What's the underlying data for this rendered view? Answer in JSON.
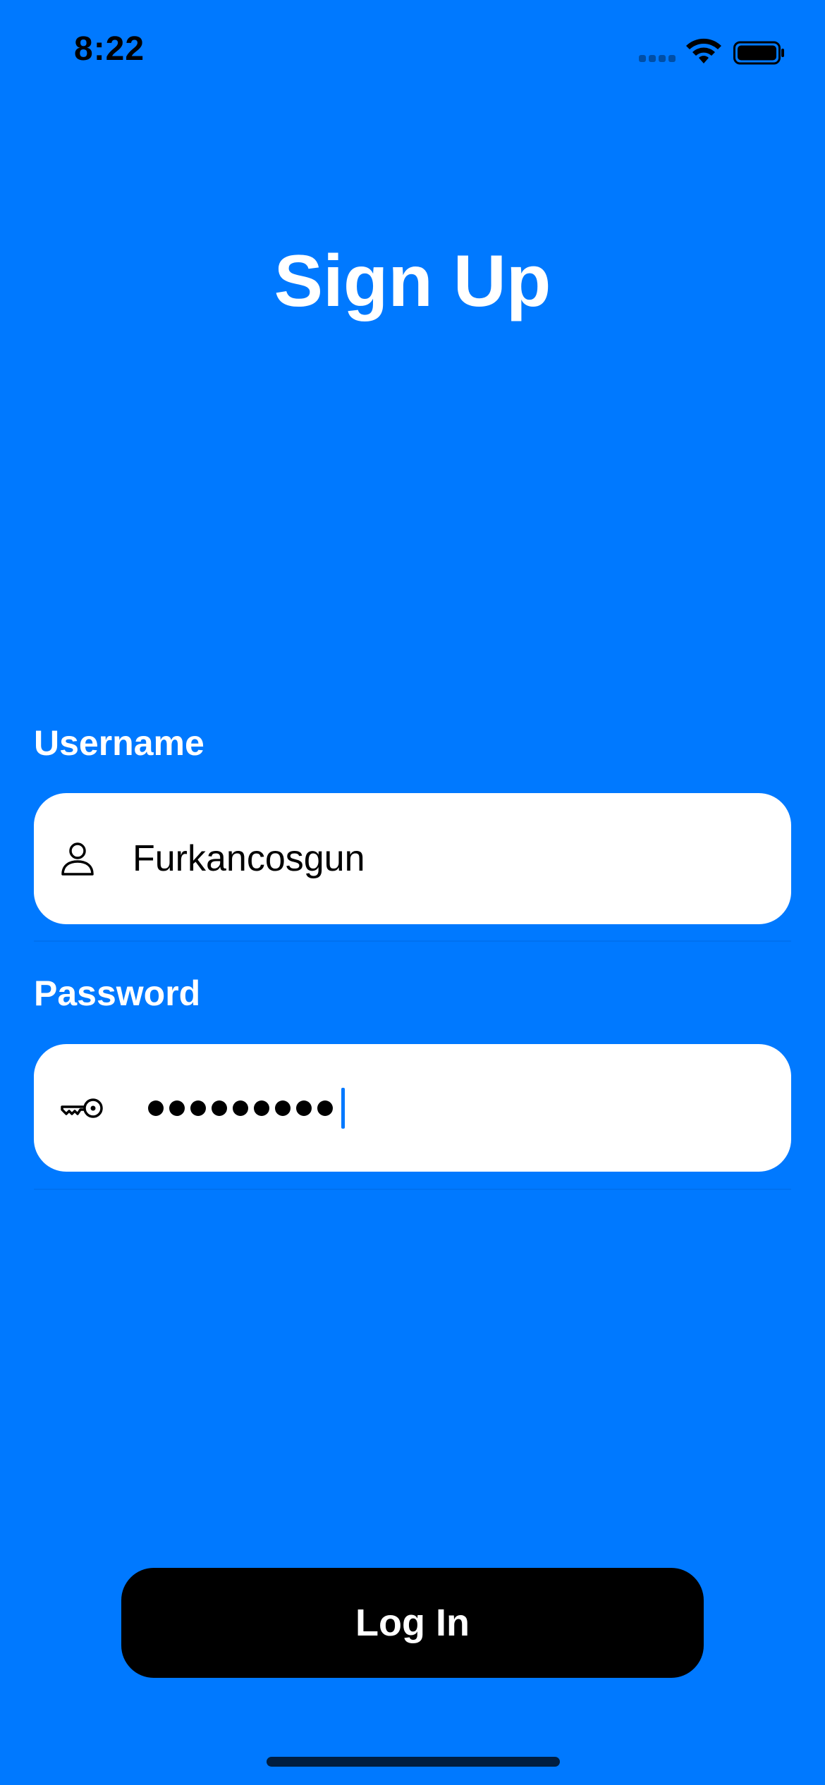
{
  "status_bar": {
    "time": "8:22",
    "signal_icon": "cellular-signal-icon",
    "wifi_icon": "wifi-icon",
    "battery_icon": "battery-icon"
  },
  "screen": {
    "title": "Sign Up"
  },
  "form": {
    "username": {
      "label": "Username",
      "value": "Furkancosgun",
      "icon": "person-icon"
    },
    "password": {
      "label": "Password",
      "masked_length": 9,
      "icon": "key-icon"
    }
  },
  "actions": {
    "login_label": "Log In"
  },
  "colors": {
    "background": "#0079FF",
    "field_bg": "#FFFFFF",
    "button_bg": "#000000",
    "cursor": "#0079FF"
  }
}
